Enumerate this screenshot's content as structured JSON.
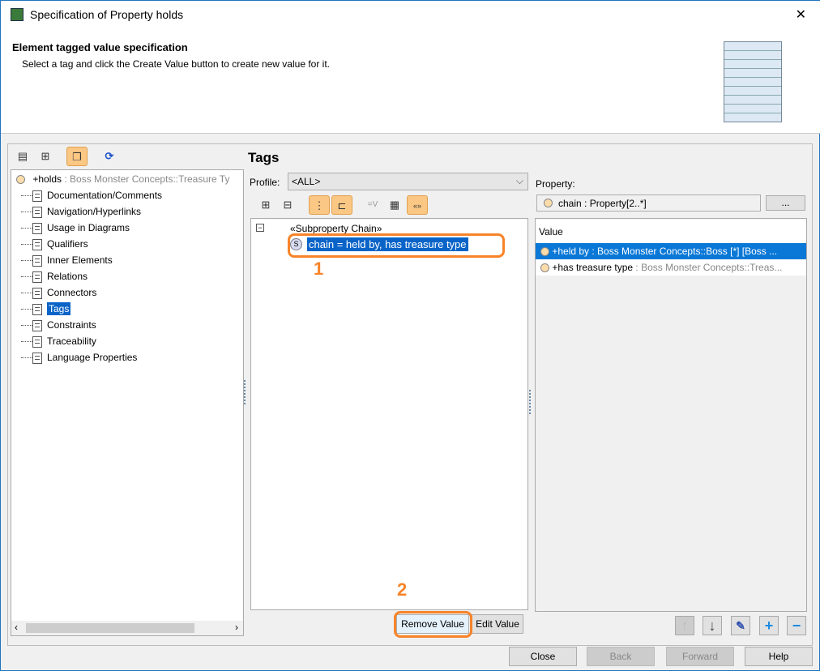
{
  "window": {
    "title": "Specification of Property holds",
    "close": "✕"
  },
  "header": {
    "title": "Element tagged value specification",
    "subtitle": "Select a tag and click the Create Value button to create new value for it."
  },
  "left_tree": {
    "root_name": "+holds",
    "root_type": " : Boss Monster Concepts::Treasure Ty",
    "items": [
      "Documentation/Comments",
      "Navigation/Hyperlinks",
      "Usage in Diagrams",
      "Qualifiers",
      "Inner Elements",
      "Relations",
      "Connectors",
      "Tags",
      "Constraints",
      "Traceability",
      "Language Properties"
    ],
    "selected": "Tags"
  },
  "tags": {
    "heading": "Tags",
    "profile_label": "Profile:",
    "profile_value": "<ALL>",
    "group": "«Subproperty Chain»",
    "tag": "chain = held by, has treasure type",
    "remove_value": "Remove Value",
    "edit_value": "Edit Value"
  },
  "property": {
    "label": "Property:",
    "value": "chain : Property[2..*]",
    "browse": "...",
    "column": "Value",
    "rows": [
      {
        "name": "+held by",
        "type": " : Boss Monster Concepts::Boss [*] [Boss ..."
      },
      {
        "name": "+has treasure type",
        "type": " : Boss Monster Concepts::Treas..."
      }
    ]
  },
  "annotations": {
    "one": "1",
    "two": "2"
  },
  "footer": {
    "close": "Close",
    "back": "Back",
    "forward": "Forward",
    "help": "Help"
  }
}
